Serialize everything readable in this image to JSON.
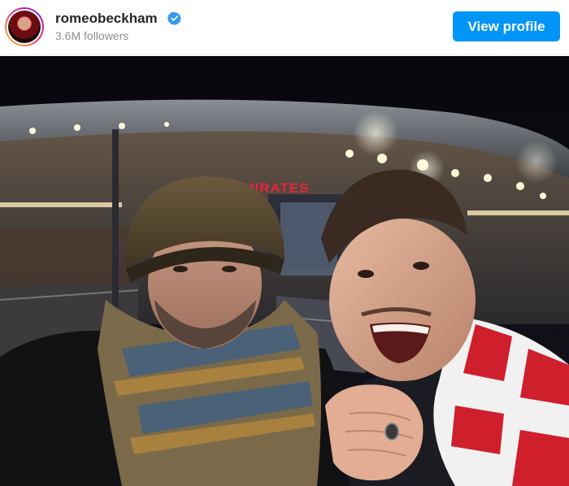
{
  "profile": {
    "username": "romeobeckham",
    "followers": "3.6M followers",
    "verified": true,
    "view_profile_label": "View profile"
  },
  "photo": {
    "stadium_sign": "EMIRATES"
  },
  "colors": {
    "button": "#0095f6",
    "verified": "#3897f0",
    "sign": "#e8253a"
  }
}
